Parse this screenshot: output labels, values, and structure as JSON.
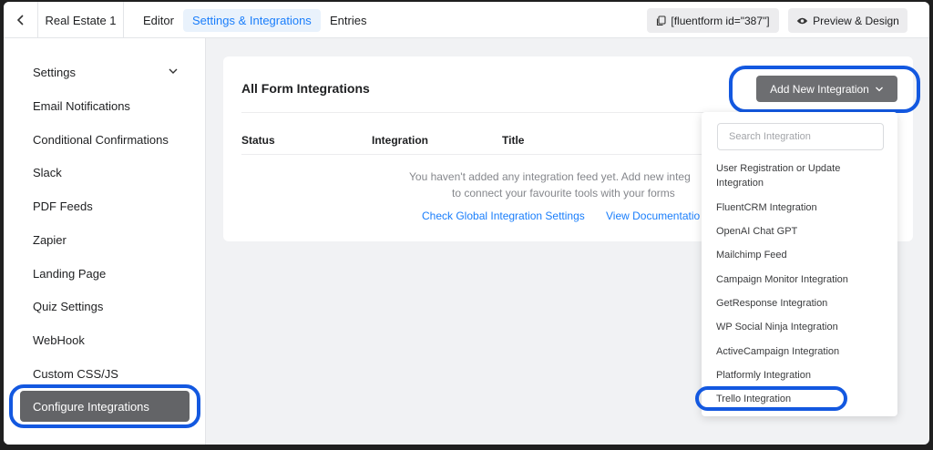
{
  "topbar": {
    "back_icon": "chevron-left-icon",
    "form_name": "Real Estate 1",
    "tabs": [
      {
        "label": "Editor"
      },
      {
        "label": "Settings & Integrations"
      },
      {
        "label": "Entries"
      }
    ],
    "shortcode_label": "[fluentform id=\"387\"]",
    "preview_label": "Preview & Design"
  },
  "sidebar": {
    "items": [
      {
        "label": "Settings"
      },
      {
        "label": "Email Notifications"
      },
      {
        "label": "Conditional Confirmations"
      },
      {
        "label": "Slack"
      },
      {
        "label": "PDF Feeds"
      },
      {
        "label": "Zapier"
      },
      {
        "label": "Landing Page"
      },
      {
        "label": "Quiz Settings"
      },
      {
        "label": "WebHook"
      },
      {
        "label": "Custom CSS/JS"
      },
      {
        "label": "Configure Integrations"
      }
    ],
    "active_index": 10
  },
  "main": {
    "title": "All Form Integrations",
    "add_button_label": "Add New Integration",
    "columns": [
      "Status",
      "Integration",
      "Title"
    ],
    "empty_line1": "You haven't added any integration feed yet. Add new integ",
    "empty_line2": "to connect your favourite tools with your forms",
    "link_global": "Check Global Integration Settings",
    "link_docs": "View Documentatio"
  },
  "dropdown": {
    "search_placeholder": "Search Integration",
    "items": [
      "User Registration or Update",
      "Integration",
      "FluentCRM Integration",
      "OpenAI Chat GPT",
      "Mailchimp Feed",
      "Campaign Monitor Integration",
      "GetResponse Integration",
      "WP Social Ninja Integration",
      "ActiveCampaign Integration",
      "Platformly Integration",
      "Trello Integration"
    ]
  },
  "colors": {
    "accent": "#1a7efb",
    "highlight_ring": "#1358e0",
    "active_sidebar": "#636467",
    "button_dark": "#6d6e71"
  }
}
